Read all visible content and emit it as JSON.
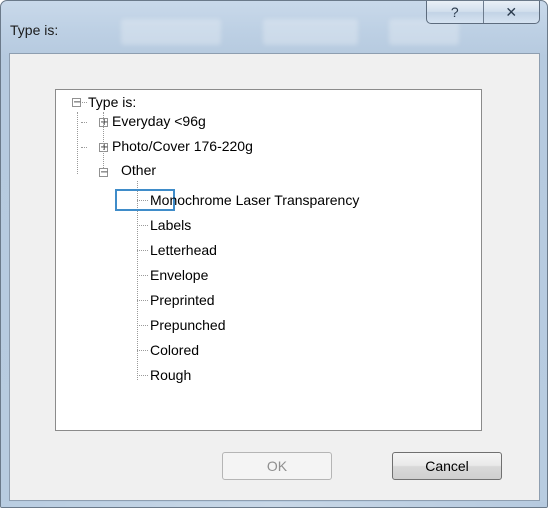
{
  "window": {
    "title": "Type is:",
    "help_glyph": "?",
    "close_glyph": "✕"
  },
  "tree": {
    "root": {
      "label": "Type is:",
      "expanded": true
    },
    "items": [
      {
        "label": "Everyday <96g",
        "expanded": false
      },
      {
        "label": "Photo/Cover 176-220g",
        "expanded": false
      },
      {
        "label": "Other",
        "expanded": true,
        "selected": true
      }
    ],
    "other_children": [
      "Monochrome Laser Transparency",
      "Labels",
      "Letterhead",
      "Envelope",
      "Preprinted",
      "Prepunched",
      "Colored",
      "Rough"
    ]
  },
  "buttons": {
    "ok": "OK",
    "cancel": "Cancel"
  },
  "colors": {
    "selection_border": "#3f8cc9",
    "window_frame": "#bdd0e4"
  },
  "icons": {
    "expand": "plus-box-icon",
    "collapse": "minus-box-icon",
    "help": "help-icon",
    "close": "close-icon"
  }
}
